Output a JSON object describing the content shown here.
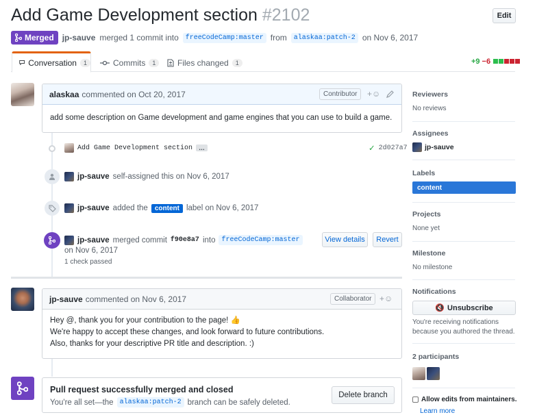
{
  "header": {
    "title": "Add Game Development section",
    "number": "#2102",
    "edit_label": "Edit",
    "state_label": "Merged",
    "merged_by": "jp-sauve",
    "merged_text": "merged 1 commit into",
    "base_branch": "freeCodeCamp:master",
    "from_text": "from",
    "head_branch": "alaskaa:patch-2",
    "date_text": "on Nov 6, 2017"
  },
  "tabs": [
    {
      "label": "Conversation",
      "count": "1"
    },
    {
      "label": "Commits",
      "count": "1"
    },
    {
      "label": "Files changed",
      "count": "1"
    }
  ],
  "diffstat": {
    "additions": "+9",
    "deletions": "−6"
  },
  "comment1": {
    "author": "alaskaa",
    "meta": "commented on Oct 20, 2017",
    "role": "Contributor",
    "body": "add some description on Game development and game engines that you can use to build a game."
  },
  "commit": {
    "message": "Add Game Development section",
    "ellipsis": "…",
    "sha": "2d027a7"
  },
  "event_assign": {
    "actor": "jp-sauve",
    "text": "self-assigned this on Nov 6, 2017"
  },
  "event_label": {
    "actor": "jp-sauve",
    "text1": "added the",
    "label": "content",
    "text2": "label on Nov 6, 2017"
  },
  "event_merge": {
    "actor": "jp-sauve",
    "text1": "merged commit",
    "sha": "f90e8a7",
    "text2": "into",
    "branch": "freeCodeCamp:master",
    "date": "on Nov 6, 2017",
    "checks": "1 check passed",
    "view_details": "View details",
    "revert": "Revert"
  },
  "comment2": {
    "author": "jp-sauve",
    "meta": "commented on Nov 6, 2017",
    "role": "Collaborator",
    "line1": "Hey @, thank you for your contribution to the page!",
    "line2": "We're happy to accept these changes, and look forward to future contributions.",
    "line3": "Also, thanks for your descriptive PR title and description. :)"
  },
  "merged_box": {
    "title": "Pull request successfully merged and closed",
    "text1": "You're all set—the",
    "branch": "alaskaa:patch-2",
    "text2": "branch can be safely deleted.",
    "button": "Delete branch"
  },
  "sidebar": {
    "reviewers_h": "Reviewers",
    "reviewers_v": "No reviews",
    "assignees_h": "Assignees",
    "assignee": "jp-sauve",
    "labels_h": "Labels",
    "label": "content",
    "projects_h": "Projects",
    "projects_v": "None yet",
    "milestone_h": "Milestone",
    "milestone_v": "No milestone",
    "notifications_h": "Notifications",
    "unsubscribe": "Unsubscribe",
    "notif_line1": "You're receiving notifications",
    "notif_line2": "because you authored the thread.",
    "participants_h": "2 participants",
    "allow_edits": "Allow edits from maintainers.",
    "learn_more": "Learn more"
  },
  "colors": {
    "merged": "#6f42c1",
    "link": "#0366d6",
    "label": "#2a77d8",
    "add": "#28a745",
    "del": "#cb2431"
  }
}
